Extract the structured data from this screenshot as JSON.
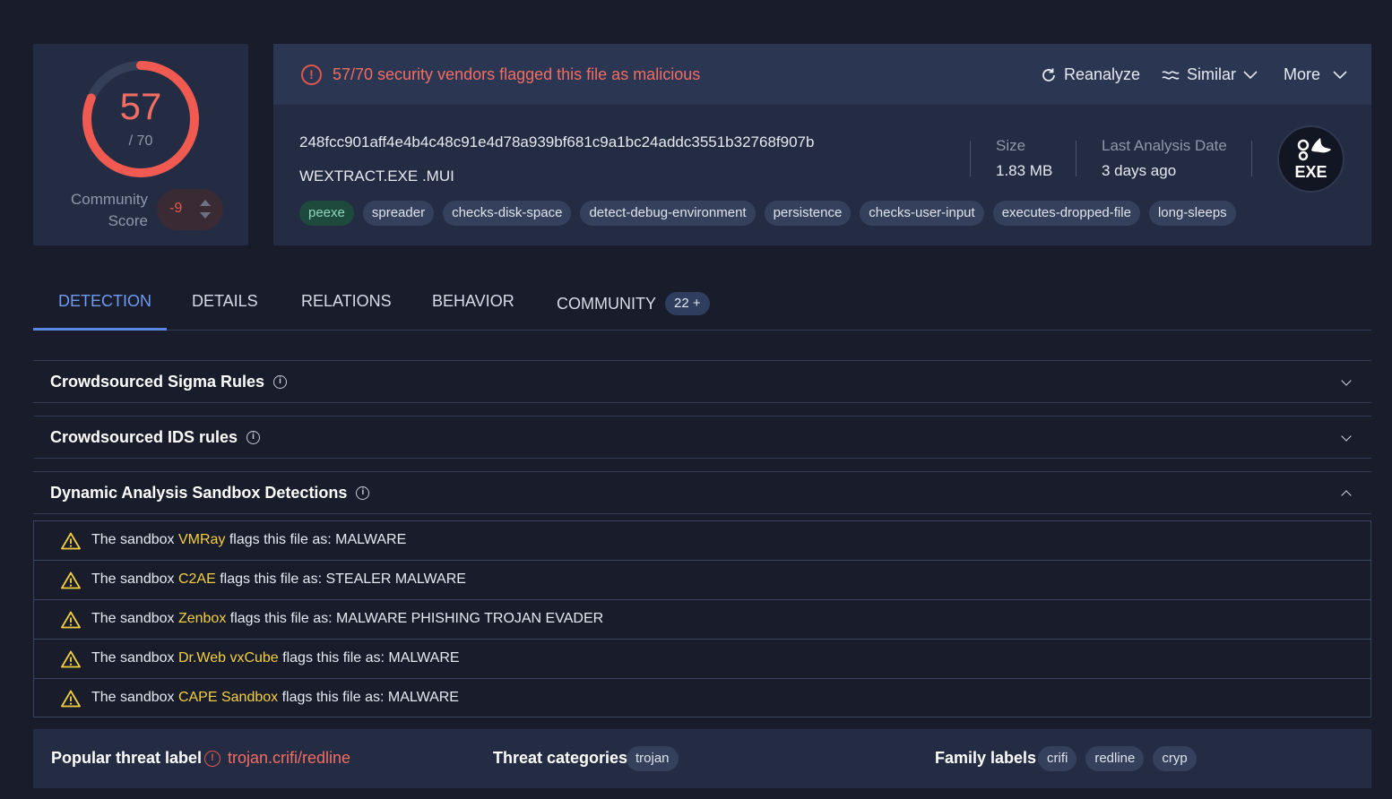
{
  "score": {
    "detections": "57",
    "total": "/ 70",
    "detection_fraction": 0.814,
    "community_label_line1": "Community",
    "community_label_line2": "Score",
    "community_value": "-9"
  },
  "header": {
    "alert_text": "57/70 security vendors flagged this file as malicious",
    "reanalyze_label": "Reanalyze",
    "similar_label": "Similar",
    "more_label": "More"
  },
  "file": {
    "hash": "248fcc901aff4e4b4c48c91e4d78a939bf681c9a1bc24addc3551b32768f907b",
    "name": "WEXTRACT.EXE .MUI",
    "tags": [
      "peexe",
      "spreader",
      "checks-disk-space",
      "detect-debug-environment",
      "persistence",
      "checks-user-input",
      "executes-dropped-file",
      "long-sleeps"
    ],
    "size_label": "Size",
    "size_value": "1.83 MB",
    "date_label": "Last Analysis Date",
    "date_value": "3 days ago",
    "type_badge": "EXE"
  },
  "tabs": {
    "detection": "DETECTION",
    "details": "DETAILS",
    "relations": "RELATIONS",
    "behavior": "BEHAVIOR",
    "community": "COMMUNITY",
    "community_count": "22 +"
  },
  "sections": {
    "sigma": "Crowdsourced Sigma Rules",
    "ids": "Crowdsourced IDS rules",
    "sandbox": "Dynamic Analysis Sandbox Detections"
  },
  "sandbox_rows": [
    {
      "prefix": "The sandbox ",
      "name": "VMRay",
      "suffix": " flags this file as: MALWARE"
    },
    {
      "prefix": "The sandbox ",
      "name": "C2AE",
      "suffix": " flags this file as: STEALER MALWARE"
    },
    {
      "prefix": "The sandbox ",
      "name": "Zenbox",
      "suffix": " flags this file as: MALWARE PHISHING TROJAN EVADER"
    },
    {
      "prefix": "The sandbox ",
      "name": "Dr.Web vxCube",
      "suffix": " flags this file as: MALWARE"
    },
    {
      "prefix": "The sandbox ",
      "name": "CAPE Sandbox",
      "suffix": " flags this file as: MALWARE"
    }
  ],
  "threat": {
    "popular_label": "Popular threat label",
    "popular_value": "trojan.crifi/redline",
    "categories_label": "Threat categories",
    "categories": [
      "trojan"
    ],
    "family_label": "Family labels",
    "families": [
      "crifi",
      "redline",
      "cryp"
    ]
  },
  "colors": {
    "accent_red": "#f26d63",
    "accent_blue": "#6f9bf0",
    "warning_yellow": "#f4d03f"
  }
}
